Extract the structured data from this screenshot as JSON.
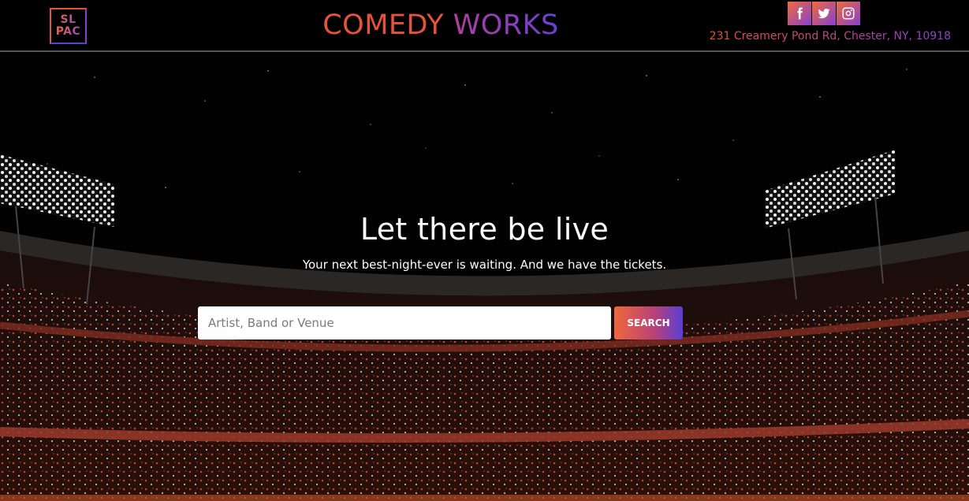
{
  "header": {
    "logo_line1": "SL",
    "logo_line2": "PAC",
    "title_part1": "COMEDY",
    "title_part2": "WORKS",
    "address": "231 Creamery Pond Rd, Chester, NY, 10918",
    "social": [
      {
        "icon": "facebook-icon"
      },
      {
        "icon": "twitter-icon"
      },
      {
        "icon": "instagram-icon"
      }
    ]
  },
  "hero": {
    "headline": "Let there be live",
    "subline": "Your next best-night-ever is waiting. And we have the tickets.",
    "search": {
      "placeholder": "Artist, Band or Venue",
      "value": "",
      "button_label": "SEARCH"
    }
  },
  "colors": {
    "accent_orange": "#e5533a",
    "accent_purple": "#6a3fd6",
    "background": "#000000"
  }
}
